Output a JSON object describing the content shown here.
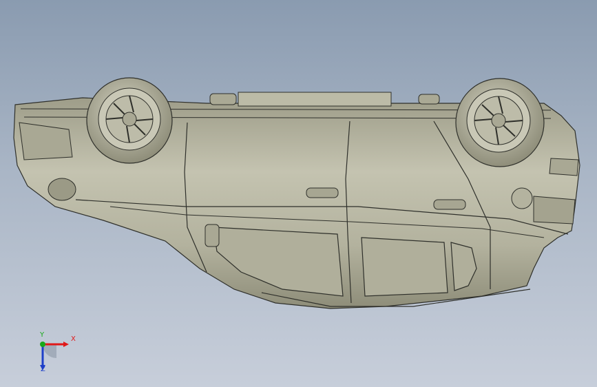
{
  "viewport": {
    "background_top": "#8a9bb0",
    "background_bottom": "#c7ceda"
  },
  "model": {
    "orientation": "upside-down",
    "body_color": "#b7b6a2",
    "line_color": "#2e2f2a"
  },
  "triad": {
    "x_label": "X",
    "y_label": "Y",
    "z_label": "Z",
    "x_color": "#e01818",
    "y_color": "#18a818",
    "z_color": "#1e3fc8"
  }
}
